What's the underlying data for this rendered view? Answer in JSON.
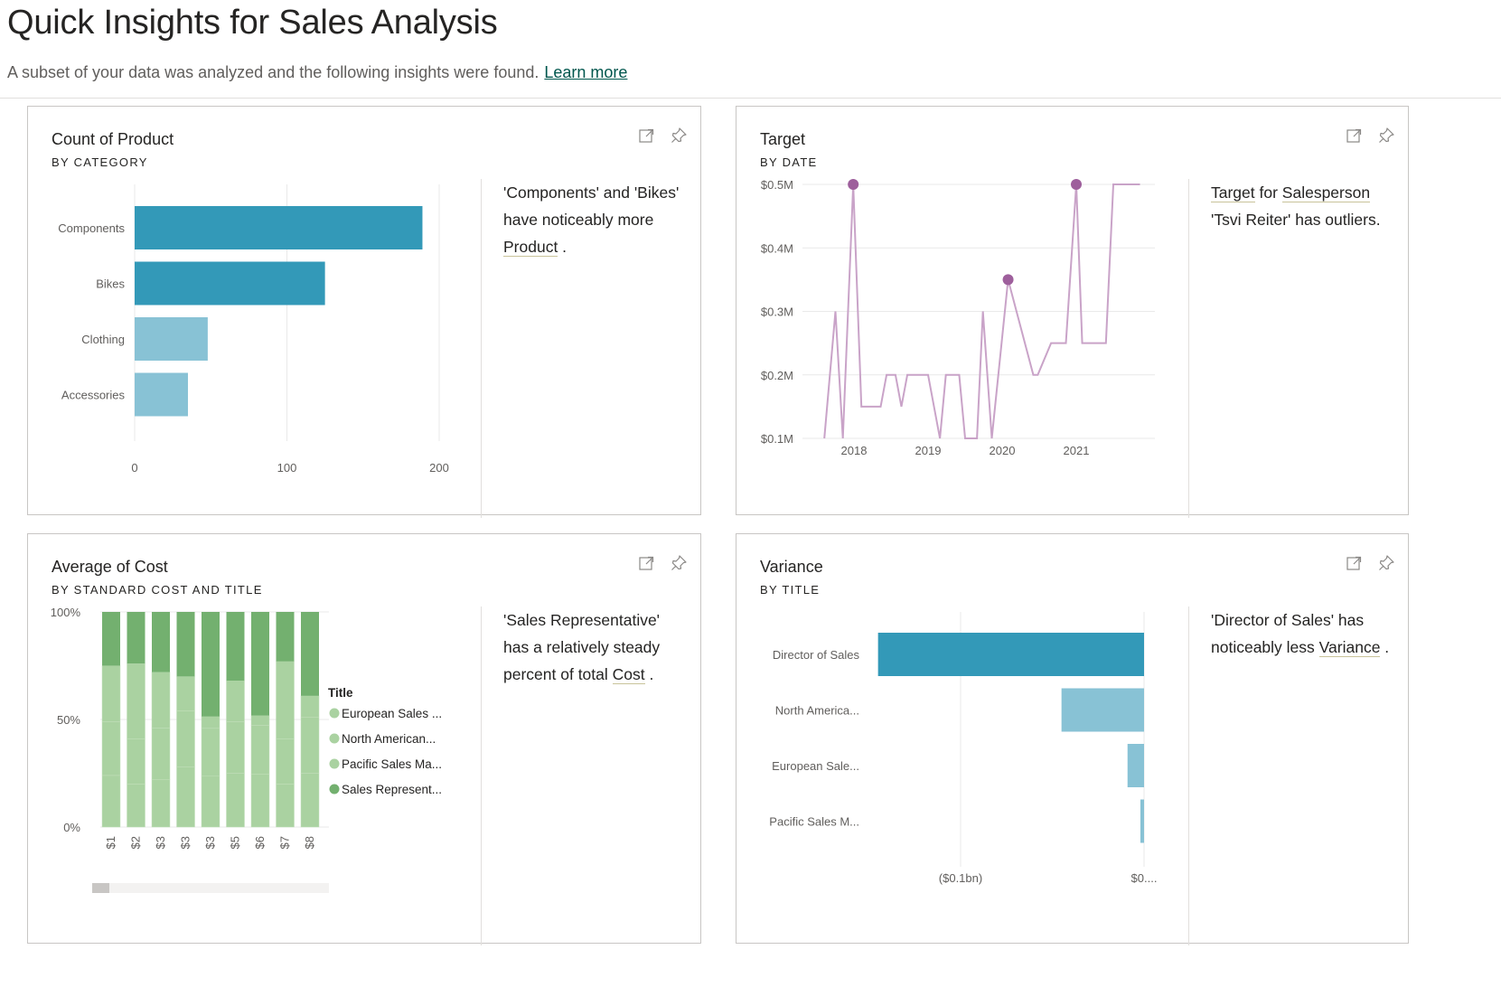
{
  "page": {
    "title": "Quick Insights for Sales Analysis",
    "subtitle": "A subset of your data was analyzed and the following insights were found.",
    "learn_more": "Learn more"
  },
  "icons": {
    "focus": "focus-mode-icon",
    "pin": "pin-icon"
  },
  "colors": {
    "teal_dark": "#3399b8",
    "teal_light": "#88c2d5",
    "purple_line": "#c9a3c8",
    "purple_marker": "#9e5f9c",
    "green_dark": "#73b06f",
    "green_light": "#aad2a1",
    "gridline": "#e9e9e9"
  },
  "cards": [
    {
      "title": "Count of Product",
      "subtitle": "BY CATEGORY",
      "insight": {
        "pre": "'Components' and 'Bikes' have noticeably more ",
        "link": "Product",
        "post": " ."
      },
      "chart_data": {
        "type": "bar",
        "orientation": "horizontal",
        "categories": [
          "Components",
          "Bikes",
          "Clothing",
          "Accessories"
        ],
        "values": [
          189,
          125,
          48,
          35
        ],
        "highlighted": [
          true,
          true,
          false,
          false
        ],
        "xlim": [
          0,
          200
        ],
        "xticks": [
          0,
          100,
          200
        ],
        "grid": true
      }
    },
    {
      "title": "Target",
      "subtitle": "BY DATE",
      "insight": {
        "link1": "Target",
        "mid": " for ",
        "link2": "Salesperson",
        "post": " 'Tsvi Reiter' has outliers."
      },
      "chart_data": {
        "type": "line",
        "x": [
          2017.6,
          2017.75,
          2017.85,
          2017.99,
          2018.1,
          2018.36,
          2018.44,
          2018.56,
          2018.64,
          2018.72,
          2018.92,
          2019.0,
          2019.16,
          2019.24,
          2019.42,
          2019.5,
          2019.66,
          2019.74,
          2019.86,
          2020.08,
          2020.42,
          2020.48,
          2020.66,
          2020.86,
          2021.0,
          2021.08,
          2021.4,
          2021.5,
          2021.86
        ],
        "y": [
          0.1,
          0.3,
          0.1,
          0.5,
          0.15,
          0.15,
          0.2,
          0.2,
          0.15,
          0.2,
          0.2,
          0.2,
          0.1,
          0.2,
          0.2,
          0.1,
          0.1,
          0.3,
          0.1,
          0.35,
          0.2,
          0.2,
          0.25,
          0.25,
          0.5,
          0.25,
          0.25,
          0.5,
          0.5
        ],
        "outliers": [
          {
            "x": 2017.99,
            "y": 0.5
          },
          {
            "x": 2020.08,
            "y": 0.35
          },
          {
            "x": 2021.0,
            "y": 0.5
          }
        ],
        "ylim": [
          0.1,
          0.5
        ],
        "yticks": [
          0.1,
          0.2,
          0.3,
          0.4,
          0.5
        ],
        "yticklabels": [
          "$0.1M",
          "$0.2M",
          "$0.3M",
          "$0.4M",
          "$0.5M"
        ],
        "xticks": [
          2018,
          2019,
          2020,
          2021
        ],
        "xticklabels": [
          "2018",
          "2019",
          "2020",
          "2021"
        ],
        "grid": true
      }
    },
    {
      "title": "Average of Cost",
      "subtitle": "BY STANDARD COST AND TITLE",
      "insight": {
        "pre": "'Sales Representative' has a relatively steady percent of total ",
        "link": "Cost",
        "post": " ."
      },
      "chart_data": {
        "type": "bar",
        "stacked": "100%",
        "categories": [
          "$1",
          "$2",
          "$3",
          "$3",
          "$3",
          "$5",
          "$6",
          "$7",
          "$8"
        ],
        "series": [
          {
            "name": "European Sales ...",
            "values": [
              24,
              20,
              22,
              28,
              26,
              25,
              27,
              20,
              25
            ]
          },
          {
            "name": "North American...",
            "values": [
              25,
              21,
              24,
              26,
              24,
              24,
              25,
              21,
              26
            ]
          },
          {
            "name": "Pacific Sales Ma...",
            "values": [
              26,
              35,
              26,
              16,
              6,
              19,
              5,
              36,
              10
            ]
          },
          {
            "name": "Sales Represent...",
            "values": [
              25,
              24,
              28,
              30,
              53,
              32,
              53,
              23,
              39
            ]
          }
        ],
        "legend_title": "Title",
        "legend_position": "right",
        "yticklabels": [
          "0%",
          "50%",
          "100%"
        ],
        "grid": true
      }
    },
    {
      "title": "Variance",
      "subtitle": "BY TITLE",
      "insight": {
        "pre": "'Director of Sales' has noticeably less ",
        "link": "Variance",
        "post": " ."
      },
      "chart_data": {
        "type": "bar",
        "orientation": "horizontal",
        "categories": [
          "Director of Sales",
          "North America...",
          "European Sale...",
          "Pacific Sales M..."
        ],
        "values": [
          -0.145,
          -0.045,
          -0.009,
          -0.002
        ],
        "highlighted": [
          true,
          false,
          false,
          false
        ],
        "xlim": [
          -0.15,
          0
        ],
        "xticks": [
          -0.1,
          0
        ],
        "xticklabels": [
          "($0.1bn)",
          "$0...."
        ],
        "grid": true
      }
    }
  ]
}
